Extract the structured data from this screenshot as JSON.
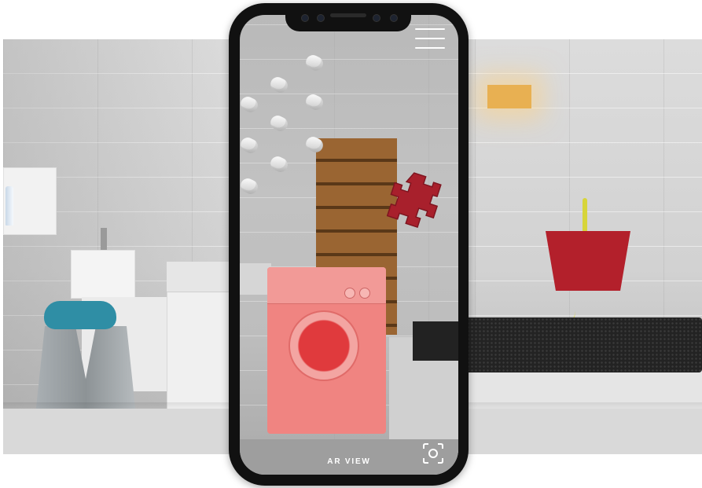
{
  "ar_screen": {
    "mode_label": "AR VIEW",
    "menu_icon": "hamburger-menu-icon",
    "capture_icon": "camera-focus-icon"
  },
  "virtual_objects": [
    "washing-machine",
    "puzzle-gear",
    "floating-cylinders"
  ],
  "colors": {
    "washer": "#f08481",
    "gear": "#a8202c",
    "screen_text": "#ffffff",
    "phone_frame": "#111111"
  }
}
